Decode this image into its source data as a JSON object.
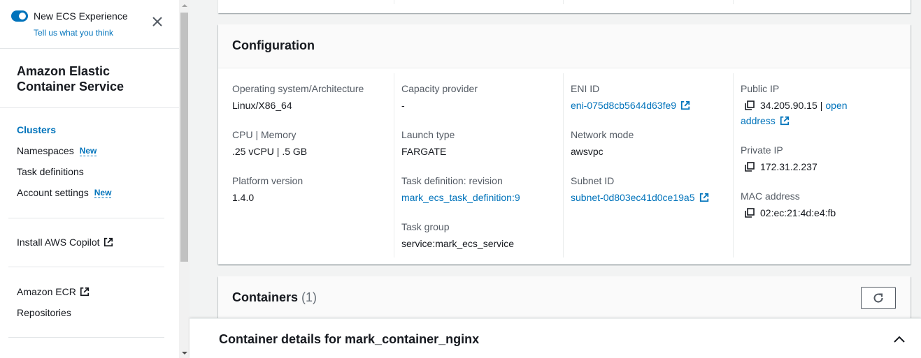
{
  "sidebar": {
    "experience_toggle_label": "New ECS Experience",
    "feedback_link": "Tell us what you think",
    "service_title": "Amazon Elastic Container Service",
    "nav": {
      "clusters": "Clusters",
      "namespaces": "Namespaces",
      "task_definitions": "Task definitions",
      "account_settings": "Account settings",
      "install_copilot": "Install AWS Copilot",
      "amazon_ecr": "Amazon ECR",
      "repositories": "Repositories"
    },
    "new_badge": "New"
  },
  "configuration": {
    "title": "Configuration",
    "os_arch": {
      "label": "Operating system/Architecture",
      "value": "Linux/X86_64"
    },
    "cpu_memory": {
      "label": "CPU | Memory",
      "value": ".25 vCPU | .5 GB"
    },
    "platform_version": {
      "label": "Platform version",
      "value": "1.4.0"
    },
    "capacity_provider": {
      "label": "Capacity provider",
      "value": "-"
    },
    "launch_type": {
      "label": "Launch type",
      "value": "FARGATE"
    },
    "task_definition": {
      "label": "Task definition: revision",
      "value": "mark_ecs_task_definition:9"
    },
    "task_group": {
      "label": "Task group",
      "value": "service:mark_ecs_service"
    },
    "eni_id": {
      "label": "ENI ID",
      "value": "eni-075d8cb5644d63fe9"
    },
    "network_mode": {
      "label": "Network mode",
      "value": "awsvpc"
    },
    "subnet_id": {
      "label": "Subnet ID",
      "value": "subnet-0d803ec41d0ce19a5"
    },
    "public_ip": {
      "label": "Public IP",
      "value": "34.205.90.15",
      "separator": "|",
      "open_word": "open",
      "address_word": "address"
    },
    "private_ip": {
      "label": "Private IP",
      "value": "172.31.2.237"
    },
    "mac_address": {
      "label": "MAC address",
      "value": "02:ec:21:4d:e4:fb"
    }
  },
  "containers": {
    "title": "Containers",
    "count": "(1)"
  },
  "container_details": {
    "title": "Container details for mark_container_nginx"
  },
  "colors": {
    "link": "#0073bb",
    "text": "#16191f",
    "label": "#545b64",
    "background": "#f2f3f3"
  }
}
